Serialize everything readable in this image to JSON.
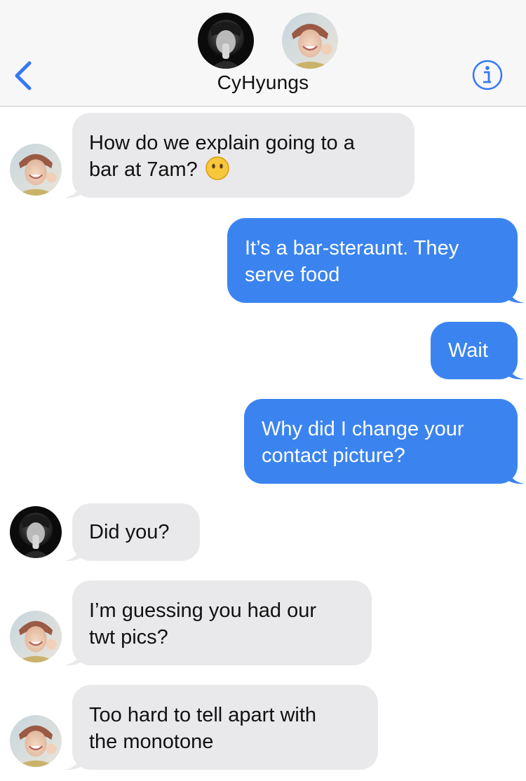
{
  "header": {
    "title": "CyHyungs",
    "back_icon": "chevron-left-icon",
    "info_icon": "info-circle-icon",
    "accent_color": "#3478f6"
  },
  "messages": [
    {
      "direction": "incoming",
      "sender": "hobi",
      "lines": [
        "How do we explain going to a",
        "bar at 7am?"
      ],
      "emoji": "no-mouth-face-emoji"
    },
    {
      "direction": "outgoing",
      "lines": [
        "It’s a bar-steraunt. They",
        "serve food"
      ]
    },
    {
      "direction": "outgoing",
      "lines": [
        "Wait"
      ]
    },
    {
      "direction": "outgoing",
      "lines": [
        "Why did I change your",
        "contact picture?"
      ]
    },
    {
      "direction": "incoming",
      "sender": "dark",
      "lines": [
        "Did you?"
      ]
    },
    {
      "direction": "incoming",
      "sender": "hobi",
      "lines": [
        "I’m guessing you had our",
        "twt pics?"
      ]
    },
    {
      "direction": "incoming",
      "sender": "hobi",
      "lines": [
        "Too hard to tell apart with",
        "the monotone"
      ]
    }
  ],
  "colors": {
    "incoming_bubble": "#e9e9eb",
    "outgoing_bubble": "#3b84f0",
    "header_bg": "#f7f7f7"
  }
}
